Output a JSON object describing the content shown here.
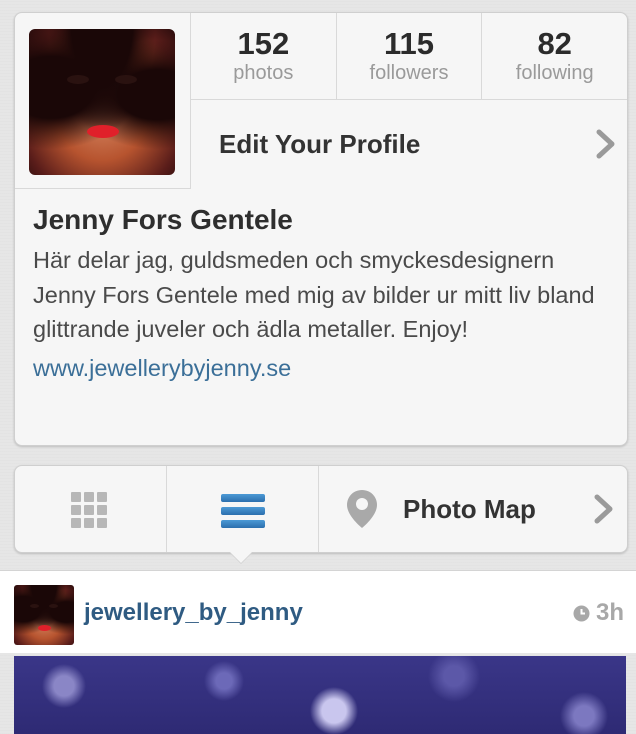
{
  "profile": {
    "stats": [
      {
        "count": "152",
        "label": "photos"
      },
      {
        "count": "115",
        "label": "followers"
      },
      {
        "count": "82",
        "label": "following"
      }
    ],
    "edit_label": "Edit Your Profile",
    "name": "Jenny Fors Gentele",
    "bio": "Här delar jag, guldsmeden och smyckesdesignern Jenny Fors Gentele med mig av bilder ur mitt liv bland glittrande juveler och ädla metaller. Enjoy!",
    "website": "www.jewellerybyjenny.se"
  },
  "nav": {
    "photo_map_label": "Photo Map",
    "active_tab": "list",
    "icons": [
      "grid-icon",
      "list-icon",
      "map-pin-icon",
      "chevron-right-icon"
    ]
  },
  "post": {
    "username": "jewellery_by_jenny",
    "time": "3h",
    "icons": [
      "clock-icon"
    ]
  },
  "colors": {
    "link": "#3b6f98",
    "username": "#2f5b82",
    "active_tab": "#3a86c8",
    "background": "#e6e6e6"
  }
}
